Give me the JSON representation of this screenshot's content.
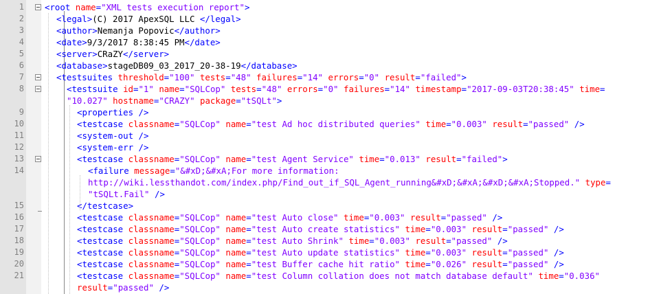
{
  "editor": {
    "colors": {
      "tag": "#0000ff",
      "attribute": "#ff0000",
      "value": "#8000ff",
      "text": "#000000",
      "line_number": "#808080",
      "gutter": "#e4e4e4"
    },
    "line_numbers": [
      "1",
      "2",
      "3",
      "4",
      "5",
      "6",
      "7",
      "8",
      "9",
      "10",
      "11",
      "12",
      "13",
      "14",
      "15",
      "16",
      "17",
      "18",
      "19",
      "20",
      "21"
    ],
    "lines": [
      {
        "segments": [
          [
            "tag",
            "<root"
          ],
          [
            "text",
            " "
          ],
          [
            "attr",
            "name"
          ],
          [
            "tag",
            "="
          ],
          [
            "val",
            "\"XML tests execution report\""
          ],
          [
            "tag",
            ">"
          ]
        ]
      },
      {
        "segments": [
          [
            "tag",
            "<legal>"
          ],
          [
            "text",
            "(C) 2017 ApexSQL LLC "
          ],
          [
            "tag",
            "</legal>"
          ]
        ]
      },
      {
        "segments": [
          [
            "tag",
            "<author>"
          ],
          [
            "text",
            "Nemanja Popovic"
          ],
          [
            "tag",
            "</author>"
          ]
        ]
      },
      {
        "segments": [
          [
            "tag",
            "<date>"
          ],
          [
            "text",
            "9/3/2017 8:38:45 PM"
          ],
          [
            "tag",
            "</date>"
          ]
        ]
      },
      {
        "segments": [
          [
            "tag",
            "<server>"
          ],
          [
            "text",
            "CRaZY"
          ],
          [
            "tag",
            "</server>"
          ]
        ]
      },
      {
        "segments": [
          [
            "tag",
            "<database>"
          ],
          [
            "text",
            "stageDB09_03_2017_20-38-19"
          ],
          [
            "tag",
            "</database>"
          ]
        ]
      },
      {
        "segments": [
          [
            "tag",
            "<testsuites"
          ],
          [
            "text",
            " "
          ],
          [
            "attr",
            "threshold"
          ],
          [
            "tag",
            "="
          ],
          [
            "val",
            "\"100\""
          ],
          [
            "text",
            " "
          ],
          [
            "attr",
            "tests"
          ],
          [
            "tag",
            "="
          ],
          [
            "val",
            "\"48\""
          ],
          [
            "text",
            " "
          ],
          [
            "attr",
            "failures"
          ],
          [
            "tag",
            "="
          ],
          [
            "val",
            "\"14\""
          ],
          [
            "text",
            " "
          ],
          [
            "attr",
            "errors"
          ],
          [
            "tag",
            "="
          ],
          [
            "val",
            "\"0\""
          ],
          [
            "text",
            " "
          ],
          [
            "attr",
            "result"
          ],
          [
            "tag",
            "="
          ],
          [
            "val",
            "\"failed\""
          ],
          [
            "tag",
            ">"
          ]
        ]
      },
      {
        "segments": [
          [
            "tag",
            "<testsuite"
          ],
          [
            "text",
            " "
          ],
          [
            "attr",
            "id"
          ],
          [
            "tag",
            "="
          ],
          [
            "val",
            "\"1\""
          ],
          [
            "text",
            " "
          ],
          [
            "attr",
            "name"
          ],
          [
            "tag",
            "="
          ],
          [
            "val",
            "\"SQLCop\""
          ],
          [
            "text",
            " "
          ],
          [
            "attr",
            "tests"
          ],
          [
            "tag",
            "="
          ],
          [
            "val",
            "\"48\""
          ],
          [
            "text",
            " "
          ],
          [
            "attr",
            "errors"
          ],
          [
            "tag",
            "="
          ],
          [
            "val",
            "\"0\""
          ],
          [
            "text",
            " "
          ],
          [
            "attr",
            "failures"
          ],
          [
            "tag",
            "="
          ],
          [
            "val",
            "\"14\""
          ],
          [
            "text",
            " "
          ],
          [
            "attr",
            "timestamp"
          ],
          [
            "tag",
            "="
          ],
          [
            "val",
            "\"2017-09-03T20:38:45\""
          ],
          [
            "text",
            " "
          ],
          [
            "attr",
            "time"
          ],
          [
            "tag",
            "="
          ]
        ]
      },
      {
        "segments": [
          [
            "val",
            "\"10.027\""
          ],
          [
            "text",
            " "
          ],
          [
            "attr",
            "hostname"
          ],
          [
            "tag",
            "="
          ],
          [
            "val",
            "\"CRAZY\""
          ],
          [
            "text",
            " "
          ],
          [
            "attr",
            "package"
          ],
          [
            "tag",
            "="
          ],
          [
            "val",
            "\"tSQLt\""
          ],
          [
            "tag",
            ">"
          ]
        ]
      },
      {
        "segments": [
          [
            "tag",
            "<properties />"
          ]
        ]
      },
      {
        "segments": [
          [
            "tag",
            "<testcase"
          ],
          [
            "text",
            " "
          ],
          [
            "attr",
            "classname"
          ],
          [
            "tag",
            "="
          ],
          [
            "val",
            "\"SQLCop\""
          ],
          [
            "text",
            " "
          ],
          [
            "attr",
            "name"
          ],
          [
            "tag",
            "="
          ],
          [
            "val",
            "\"test Ad hoc distributed queries\""
          ],
          [
            "text",
            " "
          ],
          [
            "attr",
            "time"
          ],
          [
            "tag",
            "="
          ],
          [
            "val",
            "\"0.003\""
          ],
          [
            "text",
            " "
          ],
          [
            "attr",
            "result"
          ],
          [
            "tag",
            "="
          ],
          [
            "val",
            "\"passed\""
          ],
          [
            "text",
            " "
          ],
          [
            "tag",
            "/>"
          ]
        ]
      },
      {
        "segments": [
          [
            "tag",
            "<system-out />"
          ]
        ]
      },
      {
        "segments": [
          [
            "tag",
            "<system-err />"
          ]
        ]
      },
      {
        "segments": [
          [
            "tag",
            "<testcase"
          ],
          [
            "text",
            " "
          ],
          [
            "attr",
            "classname"
          ],
          [
            "tag",
            "="
          ],
          [
            "val",
            "\"SQLCop\""
          ],
          [
            "text",
            " "
          ],
          [
            "attr",
            "name"
          ],
          [
            "tag",
            "="
          ],
          [
            "val",
            "\"test Agent Service\""
          ],
          [
            "text",
            " "
          ],
          [
            "attr",
            "time"
          ],
          [
            "tag",
            "="
          ],
          [
            "val",
            "\"0.013\""
          ],
          [
            "text",
            " "
          ],
          [
            "attr",
            "result"
          ],
          [
            "tag",
            "="
          ],
          [
            "val",
            "\"failed\""
          ],
          [
            "tag",
            ">"
          ]
        ]
      },
      {
        "segments": [
          [
            "tag",
            "<failure"
          ],
          [
            "text",
            " "
          ],
          [
            "attr",
            "message"
          ],
          [
            "tag",
            "="
          ],
          [
            "val",
            "\"&#xD;&#xA;For more information:"
          ]
        ]
      },
      {
        "segments": [
          [
            "val",
            "http://wiki.lessthandot.com/index.php/Find_out_if_SQL_Agent_running&#xD;&#xA;&#xD;&#xA;Stopped.\""
          ],
          [
            "text",
            " "
          ],
          [
            "attr",
            "type"
          ],
          [
            "tag",
            "="
          ]
        ]
      },
      {
        "segments": [
          [
            "val",
            "\"tSQLt.Fail\""
          ],
          [
            "text",
            " "
          ],
          [
            "tag",
            "/>"
          ]
        ]
      },
      {
        "segments": [
          [
            "tag",
            "</testcase>"
          ]
        ]
      },
      {
        "segments": [
          [
            "tag",
            "<testcase"
          ],
          [
            "text",
            " "
          ],
          [
            "attr",
            "classname"
          ],
          [
            "tag",
            "="
          ],
          [
            "val",
            "\"SQLCop\""
          ],
          [
            "text",
            " "
          ],
          [
            "attr",
            "name"
          ],
          [
            "tag",
            "="
          ],
          [
            "val",
            "\"test Auto close\""
          ],
          [
            "text",
            " "
          ],
          [
            "attr",
            "time"
          ],
          [
            "tag",
            "="
          ],
          [
            "val",
            "\"0.003\""
          ],
          [
            "text",
            " "
          ],
          [
            "attr",
            "result"
          ],
          [
            "tag",
            "="
          ],
          [
            "val",
            "\"passed\""
          ],
          [
            "text",
            " "
          ],
          [
            "tag",
            "/>"
          ]
        ]
      },
      {
        "segments": [
          [
            "tag",
            "<testcase"
          ],
          [
            "text",
            " "
          ],
          [
            "attr",
            "classname"
          ],
          [
            "tag",
            "="
          ],
          [
            "val",
            "\"SQLCop\""
          ],
          [
            "text",
            " "
          ],
          [
            "attr",
            "name"
          ],
          [
            "tag",
            "="
          ],
          [
            "val",
            "\"test Auto create statistics\""
          ],
          [
            "text",
            " "
          ],
          [
            "attr",
            "time"
          ],
          [
            "tag",
            "="
          ],
          [
            "val",
            "\"0.003\""
          ],
          [
            "text",
            " "
          ],
          [
            "attr",
            "result"
          ],
          [
            "tag",
            "="
          ],
          [
            "val",
            "\"passed\""
          ],
          [
            "text",
            " "
          ],
          [
            "tag",
            "/>"
          ]
        ]
      },
      {
        "segments": [
          [
            "tag",
            "<testcase"
          ],
          [
            "text",
            " "
          ],
          [
            "attr",
            "classname"
          ],
          [
            "tag",
            "="
          ],
          [
            "val",
            "\"SQLCop\""
          ],
          [
            "text",
            " "
          ],
          [
            "attr",
            "name"
          ],
          [
            "tag",
            "="
          ],
          [
            "val",
            "\"test Auto Shrink\""
          ],
          [
            "text",
            " "
          ],
          [
            "attr",
            "time"
          ],
          [
            "tag",
            "="
          ],
          [
            "val",
            "\"0.003\""
          ],
          [
            "text",
            " "
          ],
          [
            "attr",
            "result"
          ],
          [
            "tag",
            "="
          ],
          [
            "val",
            "\"passed\""
          ],
          [
            "text",
            " "
          ],
          [
            "tag",
            "/>"
          ]
        ]
      },
      {
        "segments": [
          [
            "tag",
            "<testcase"
          ],
          [
            "text",
            " "
          ],
          [
            "attr",
            "classname"
          ],
          [
            "tag",
            "="
          ],
          [
            "val",
            "\"SQLCop\""
          ],
          [
            "text",
            " "
          ],
          [
            "attr",
            "name"
          ],
          [
            "tag",
            "="
          ],
          [
            "val",
            "\"test Auto update statistics\""
          ],
          [
            "text",
            " "
          ],
          [
            "attr",
            "time"
          ],
          [
            "tag",
            "="
          ],
          [
            "val",
            "\"0.003\""
          ],
          [
            "text",
            " "
          ],
          [
            "attr",
            "result"
          ],
          [
            "tag",
            "="
          ],
          [
            "val",
            "\"passed\""
          ],
          [
            "text",
            " "
          ],
          [
            "tag",
            "/>"
          ]
        ]
      },
      {
        "segments": [
          [
            "tag",
            "<testcase"
          ],
          [
            "text",
            " "
          ],
          [
            "attr",
            "classname"
          ],
          [
            "tag",
            "="
          ],
          [
            "val",
            "\"SQLCop\""
          ],
          [
            "text",
            " "
          ],
          [
            "attr",
            "name"
          ],
          [
            "tag",
            "="
          ],
          [
            "val",
            "\"test Buffer cache hit ratio\""
          ],
          [
            "text",
            " "
          ],
          [
            "attr",
            "time"
          ],
          [
            "tag",
            "="
          ],
          [
            "val",
            "\"0.026\""
          ],
          [
            "text",
            " "
          ],
          [
            "attr",
            "result"
          ],
          [
            "tag",
            "="
          ],
          [
            "val",
            "\"passed\""
          ],
          [
            "text",
            " "
          ],
          [
            "tag",
            "/>"
          ]
        ]
      },
      {
        "segments": [
          [
            "tag",
            "<testcase"
          ],
          [
            "text",
            " "
          ],
          [
            "attr",
            "classname"
          ],
          [
            "tag",
            "="
          ],
          [
            "val",
            "\"SQLCop\""
          ],
          [
            "text",
            " "
          ],
          [
            "attr",
            "name"
          ],
          [
            "tag",
            "="
          ],
          [
            "val",
            "\"test Column collation does not match database default\""
          ],
          [
            "text",
            " "
          ],
          [
            "attr",
            "time"
          ],
          [
            "tag",
            "="
          ],
          [
            "val",
            "\"0.036\""
          ]
        ]
      },
      {
        "segments": [
          [
            "attr",
            "result"
          ],
          [
            "tag",
            "="
          ],
          [
            "val",
            "\"passed\""
          ],
          [
            "text",
            " "
          ],
          [
            "tag",
            "/>"
          ]
        ]
      }
    ]
  }
}
